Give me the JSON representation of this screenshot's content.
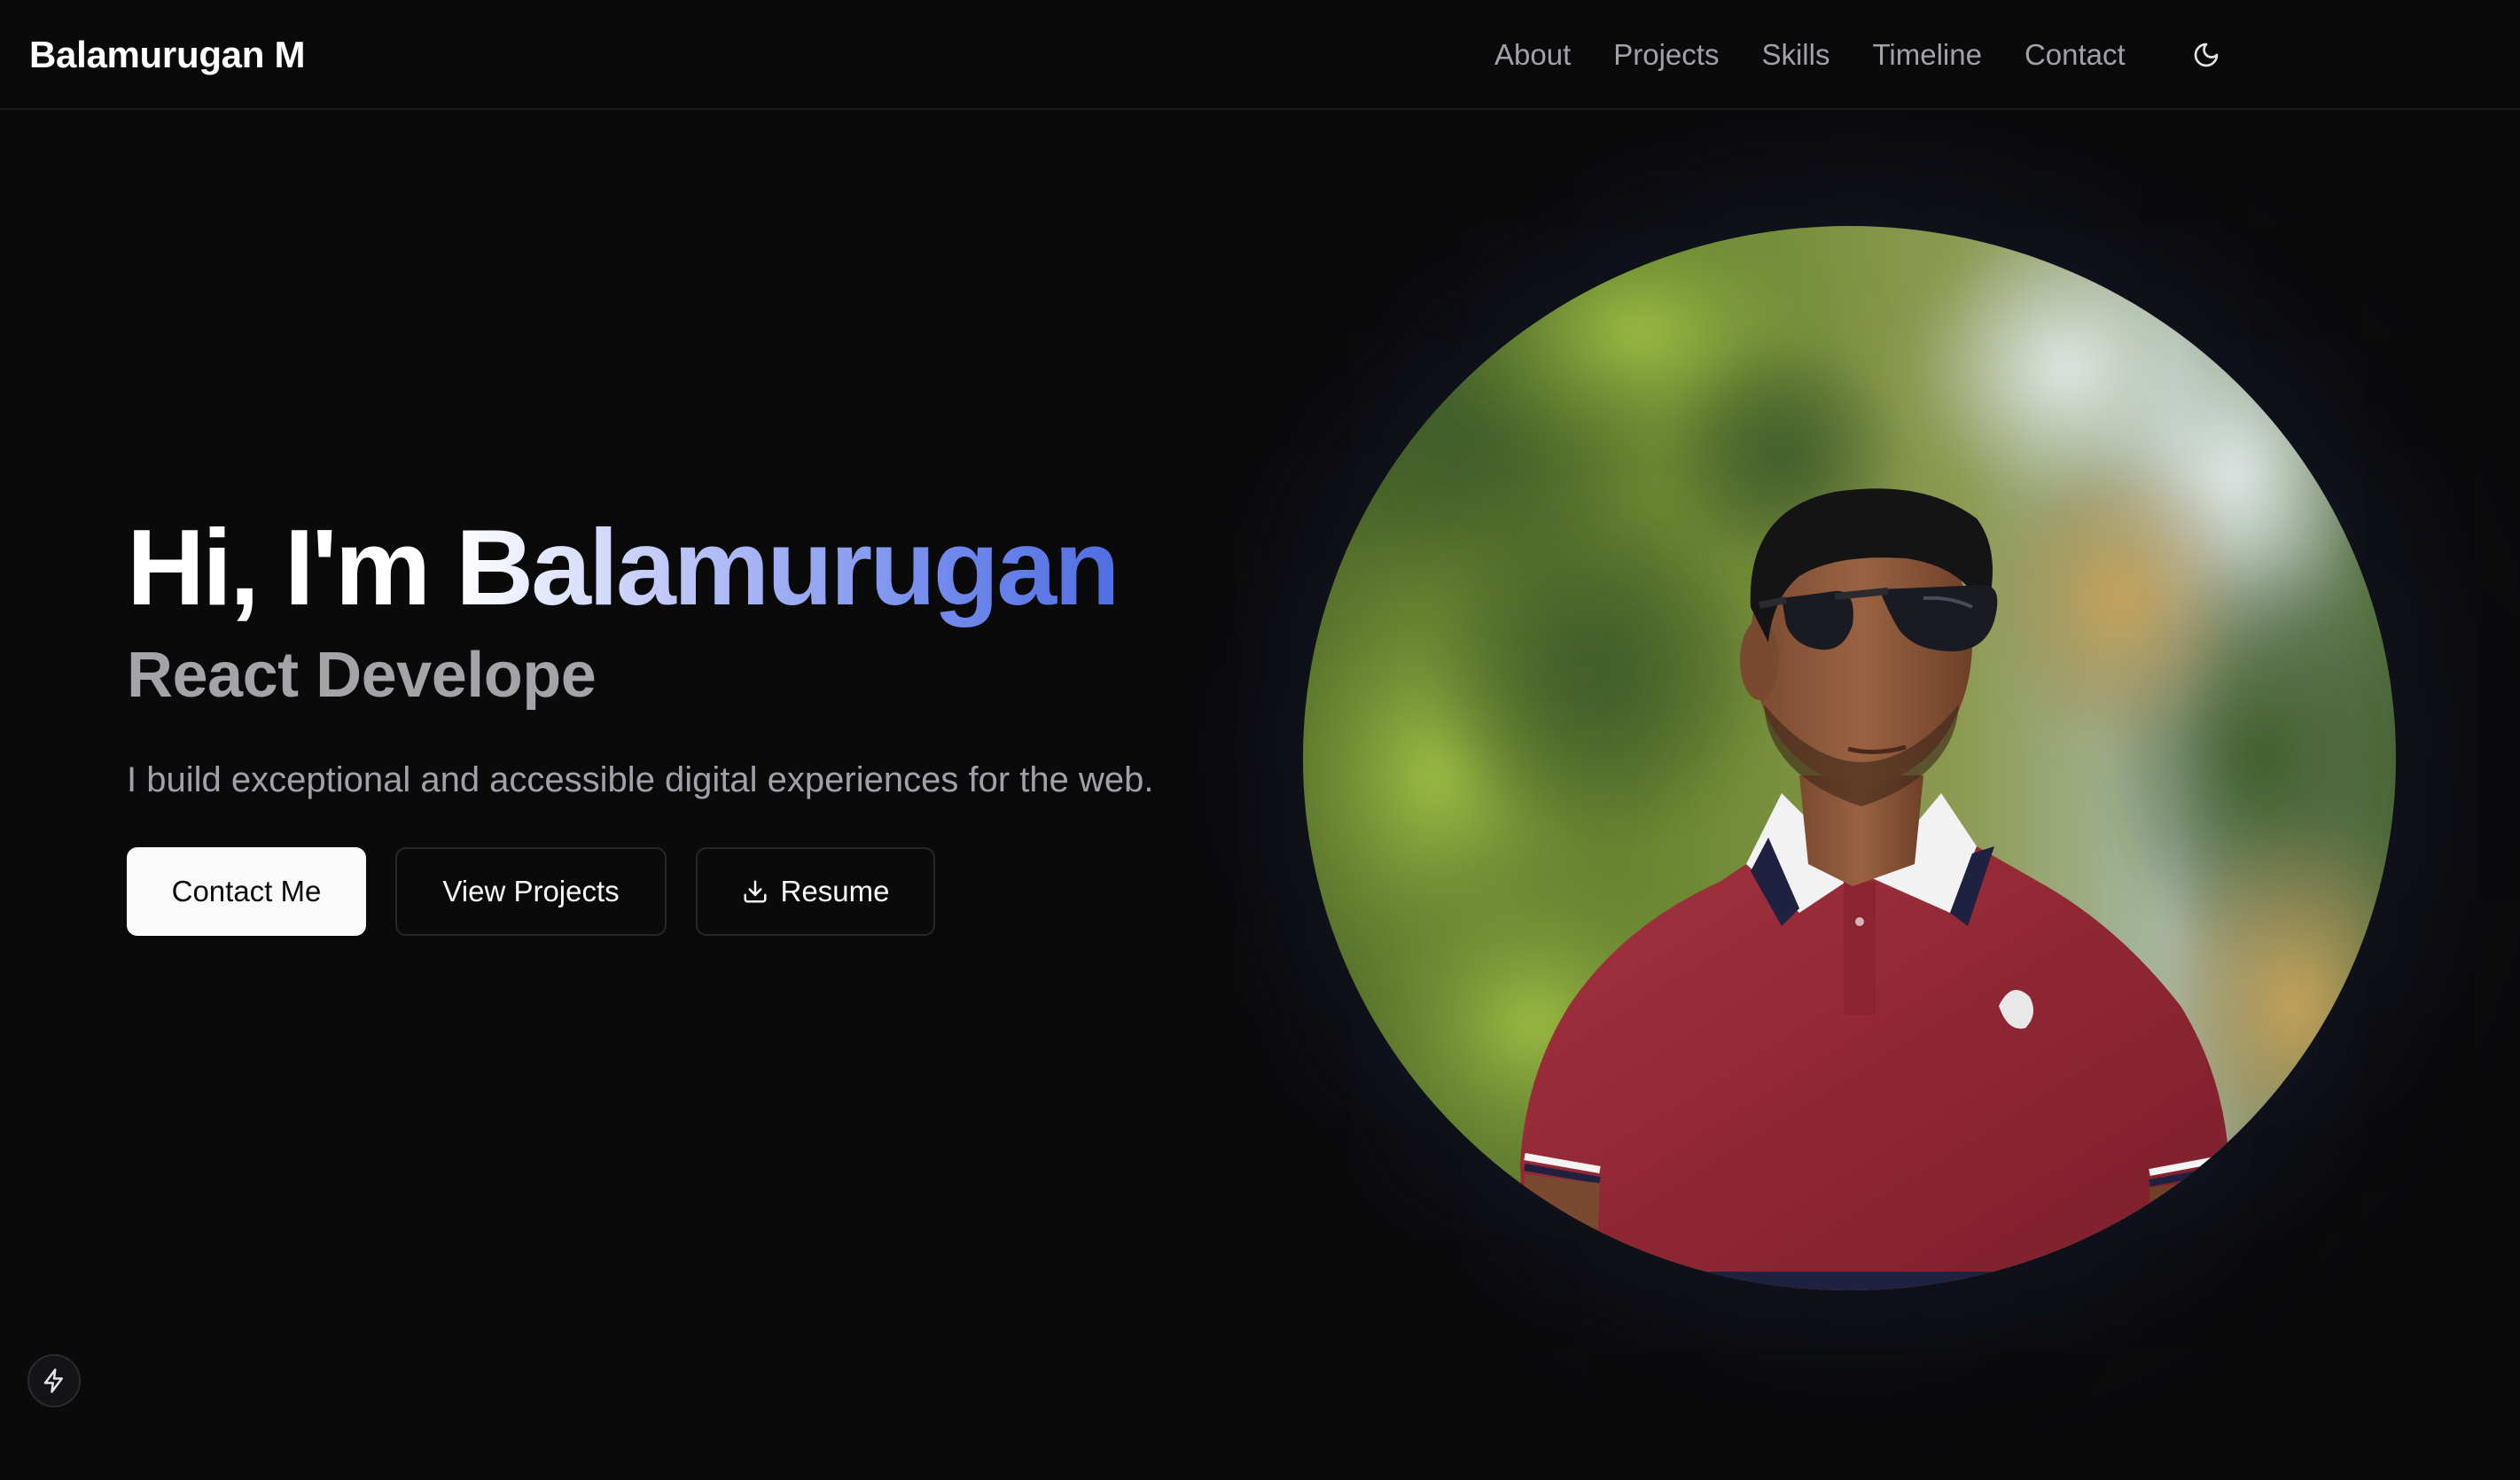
{
  "nav": {
    "brand": "Balamurugan M",
    "links": [
      {
        "label": "About"
      },
      {
        "label": "Projects"
      },
      {
        "label": "Skills"
      },
      {
        "label": "Timeline"
      },
      {
        "label": "Contact"
      }
    ],
    "theme_icon": "moon-icon"
  },
  "hero": {
    "greeting": "Hi, I'm ",
    "name": "Balamurugan",
    "role": "React Develope",
    "description": "I build exceptional and accessible digital experiences for the web.",
    "buttons": {
      "contact": "Contact Me",
      "projects": "View Projects",
      "resume": "Resume",
      "resume_icon": "download-icon"
    },
    "portrait_icon": "profile-photo"
  },
  "floating_badge": {
    "icon": "lightning-bolt-icon"
  },
  "colors": {
    "background": "#0a0a0b",
    "accent_gradient_end": "#4f6ee0",
    "muted_text": "#a1a1aa",
    "primary_button_bg": "#fafafa"
  }
}
